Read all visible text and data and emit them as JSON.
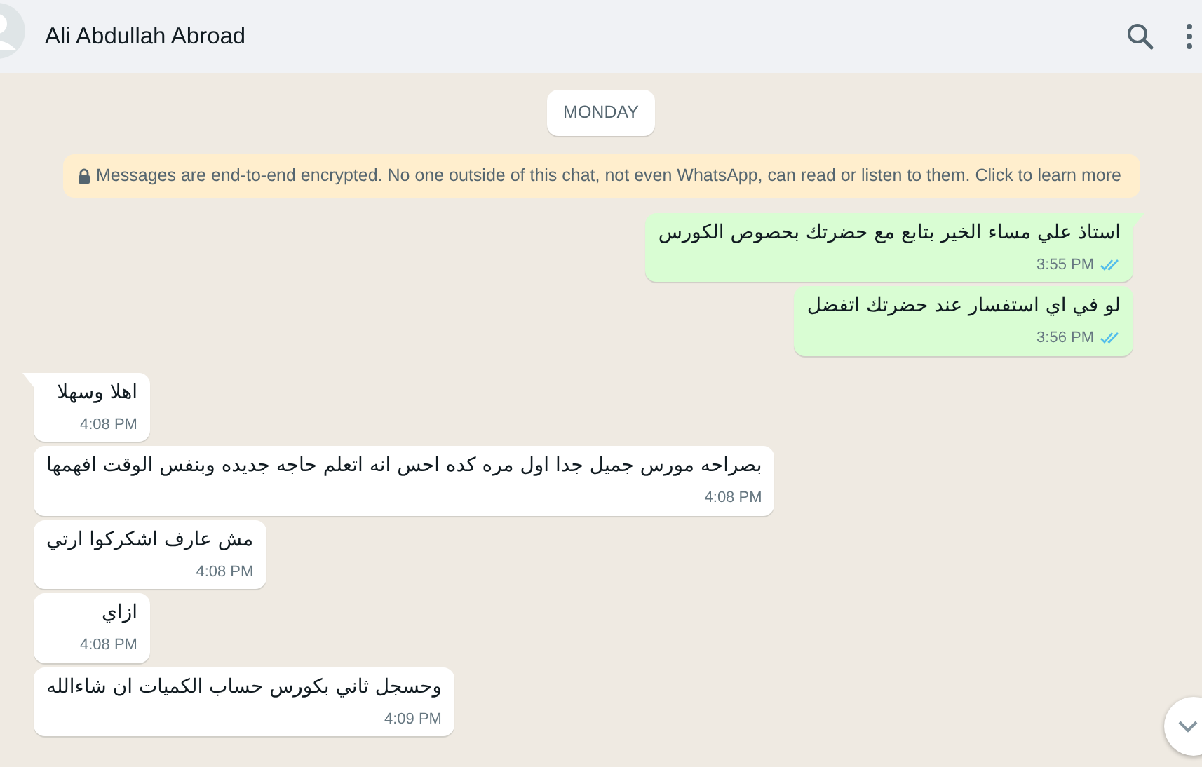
{
  "header": {
    "contact_name": "Ali Abdullah Abroad"
  },
  "day_label": "MONDAY",
  "encryption_notice": "Messages are end-to-end encrypted. No one outside of this chat, not even WhatsApp, can read or listen to them. Click to learn more",
  "messages": [
    {
      "outgoing": true,
      "tail": true,
      "text": "استاذ علي مساء الخير بتابع مع حضرتك بحصوص الكورس",
      "time": "3:55 PM",
      "read": true
    },
    {
      "outgoing": true,
      "tail": false,
      "text": "لو في اي استفسار عند حضرتك اتفضل",
      "time": "3:56 PM",
      "read": true
    },
    {
      "outgoing": false,
      "tail": true,
      "text": "اهلا وسهلا",
      "time": "4:08 PM"
    },
    {
      "outgoing": false,
      "tail": false,
      "text": "بصراحه مورس جميل جدا اول مره كده احس انه اتعلم حاجه جديده وبنفس الوقت افهمها",
      "time": "4:08 PM"
    },
    {
      "outgoing": false,
      "tail": false,
      "text": "مش عارف اشكركوا ارتي",
      "time": "4:08 PM"
    },
    {
      "outgoing": false,
      "tail": false,
      "text": "ازاي",
      "time": "4:08 PM"
    },
    {
      "outgoing": false,
      "tail": false,
      "text": "وحسجل ثاني بكورس حساب الكميات ان شاءالله",
      "time": "4:09 PM"
    }
  ]
}
